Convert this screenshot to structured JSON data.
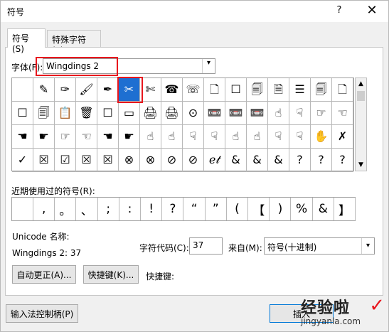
{
  "window": {
    "title": "符号",
    "help_label": "?",
    "close_label": "✕"
  },
  "tabs": [
    {
      "label": "符号(S)"
    },
    {
      "label": "特殊字符(P)"
    }
  ],
  "font": {
    "label": "字体(F):",
    "value": "Wingdings 2"
  },
  "symbol_grid": {
    "rows": [
      [
        "",
        "✎",
        "✑",
        "🖌",
        "✒",
        "✂",
        "✄",
        "☎",
        "☏",
        "🗋",
        "☐",
        "🗐",
        "🗎",
        "☰",
        "🗐",
        "🗋"
      ],
      [
        "☐",
        "🗐",
        "📋",
        "🗑",
        "☐",
        "▭",
        "🖨",
        "🖨",
        "⊙",
        "📼",
        "📼",
        "📼",
        "☝",
        "☟",
        "☞",
        "☜"
      ],
      [
        "☚",
        "☛",
        "☞",
        "☜",
        "☚",
        "☛",
        "☝",
        "☝",
        "☟",
        "☟",
        "☝",
        "☝",
        "☟",
        "☟",
        "✋",
        "✗"
      ],
      [
        "✓",
        "☒",
        "☑",
        "☒",
        "☒",
        "⊗",
        "⊗",
        "⊘",
        "⊘",
        "ℯ𝓉",
        "&",
        "&",
        "&",
        "?",
        "?",
        "?"
      ]
    ],
    "selected": "row 1, column 6"
  },
  "recent": {
    "label": "近期使用过的符号(R):",
    "items": [
      "",
      ",",
      "。",
      "、",
      ";",
      ":",
      "!",
      "?",
      "“",
      "”",
      "(",
      "【",
      ")",
      "%",
      "&",
      "】"
    ]
  },
  "unicode": {
    "label": "Unicode 名称:",
    "value": "Wingdings 2: 37"
  },
  "char_code": {
    "label": "字符代码(C):",
    "value": "37"
  },
  "from": {
    "label": "来自(M):",
    "value": "符号(十进制)"
  },
  "buttons": {
    "autocorrect": "自动更正(A)...",
    "shortcut_key": "快捷键(K)...",
    "shortcut_label": "快捷键:",
    "ime": "输入法控制柄(P)",
    "insert": "插入"
  },
  "watermark": {
    "text": "经验啦",
    "url": "jingyanla.com",
    "check": "✓"
  },
  "colors": {
    "selection": "#1e6fd1",
    "highlight_box": "#e8161d"
  }
}
